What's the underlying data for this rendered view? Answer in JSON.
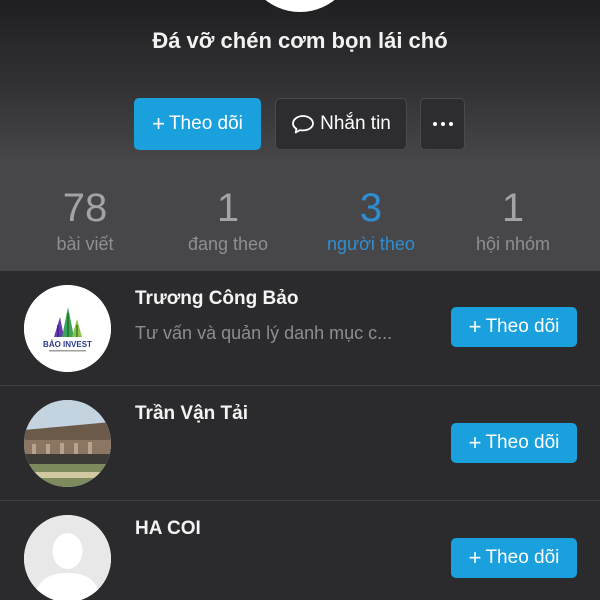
{
  "profile": {
    "name": "Đá vỡ chén cơm bọn lái chó"
  },
  "actions": {
    "follow_label": "Theo dõi",
    "message_label": "Nhắn tin",
    "follow_icon": "plus-icon",
    "message_icon": "chat-bubble-icon",
    "more_icon": "more-dots-icon"
  },
  "stats": [
    {
      "value": "78",
      "label": "bài viết"
    },
    {
      "value": "1",
      "label": "đang theo"
    },
    {
      "value": "3",
      "label": "người theo",
      "active": true
    },
    {
      "value": "1",
      "label": "hội nhóm"
    }
  ],
  "followers": [
    {
      "name": "Trương Công Bảo",
      "description": "Tư vấn và quản lý danh mục c...",
      "follow_label": "Theo dõi",
      "avatar_logo_text": "BẢO INVEST"
    },
    {
      "name": "Trần Vận Tải",
      "description": "",
      "follow_label": "Theo dõi"
    },
    {
      "name": "HA COI",
      "description": "",
      "follow_label": "Theo dõi"
    }
  ],
  "colors": {
    "accent": "#1aa1dd",
    "active_stat": "#2f8ed2",
    "background": "#2b2b2d",
    "stats_bar": "#47474a"
  }
}
